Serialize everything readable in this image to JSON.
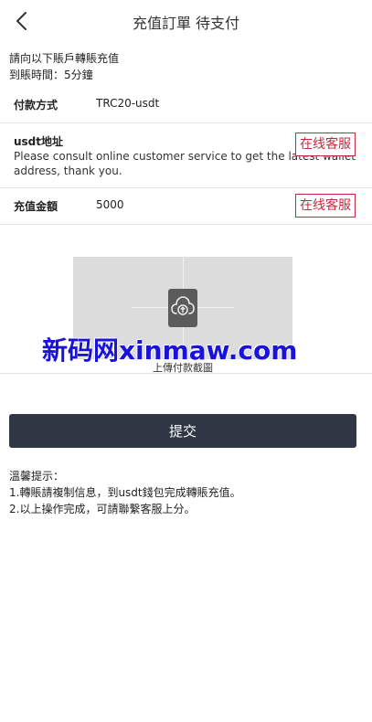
{
  "header": {
    "title": "充值訂單 待支付"
  },
  "notice": {
    "line1": "請向以下賬戶轉賬充值",
    "line2": "到賬時間：5分鐘"
  },
  "payment_method": {
    "label": "付款方式",
    "value": "TRC20-usdt"
  },
  "address": {
    "label": "usdt地址",
    "note": "Please consult online customer service to get the latest wallet address, thank you.",
    "cs_button": "在线客服"
  },
  "amount": {
    "label": "充值金額",
    "value": "5000",
    "cs_button": "在线客服"
  },
  "upload": {
    "label": "上傳付款截圖",
    "icon": "upload-cloud-icon"
  },
  "watermark": "新码网xinmaw.com",
  "submit": {
    "label": "提交"
  },
  "tips": {
    "title": "溫馨提示：",
    "line1": "1.轉賬請複制信息，到usdt錢包完成轉賬充值。",
    "line2": "2.以上操作完成，可請聯繫客服上分。"
  },
  "colors": {
    "accent_red": "#c8283e",
    "submit_bg": "#2f3745",
    "upload_bg": "#dcdcdc",
    "watermark": "#1a12d8"
  }
}
